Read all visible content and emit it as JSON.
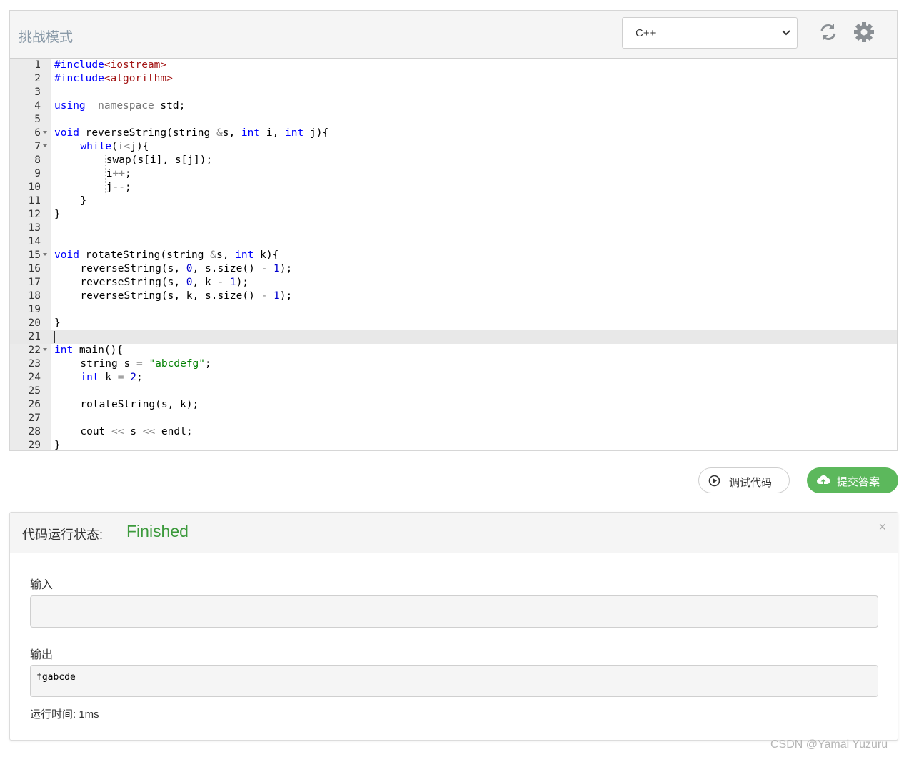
{
  "header": {
    "title": "挑战模式",
    "language_value": "C++",
    "refresh_icon": "refresh-icon",
    "settings_icon": "gear-icon"
  },
  "editor": {
    "lines": [
      {
        "n": "1",
        "fold": false,
        "indent": 0,
        "tokens": [
          [
            "inc",
            "#include"
          ],
          [
            "incf",
            "<iostream>"
          ]
        ]
      },
      {
        "n": "2",
        "fold": false,
        "indent": 0,
        "tokens": [
          [
            "inc",
            "#include"
          ],
          [
            "incf",
            "<algorithm>"
          ]
        ]
      },
      {
        "n": "3",
        "fold": false,
        "indent": 0,
        "tokens": []
      },
      {
        "n": "4",
        "fold": false,
        "indent": 0,
        "tokens": [
          [
            "kw",
            "using"
          ],
          [
            "",
            "  "
          ],
          [
            "gray",
            "namespace"
          ],
          [
            "",
            " std;"
          ]
        ]
      },
      {
        "n": "5",
        "fold": false,
        "indent": 0,
        "tokens": []
      },
      {
        "n": "6",
        "fold": true,
        "indent": 0,
        "tokens": [
          [
            "kw",
            "void"
          ],
          [
            "",
            " reverseString(string "
          ],
          [
            "op",
            "&"
          ],
          [
            "",
            "s, "
          ],
          [
            "kw",
            "int"
          ],
          [
            "",
            " i, "
          ],
          [
            "kw",
            "int"
          ],
          [
            "",
            " j){"
          ]
        ]
      },
      {
        "n": "7",
        "fold": true,
        "indent": 1,
        "tokens": [
          [
            "kw",
            "while"
          ],
          [
            "",
            "(i"
          ],
          [
            "op",
            "<"
          ],
          [
            "",
            "j){"
          ]
        ]
      },
      {
        "n": "8",
        "fold": false,
        "indent": 2,
        "tokens": [
          [
            "",
            "swap(s[i], s[j]);"
          ]
        ]
      },
      {
        "n": "9",
        "fold": false,
        "indent": 2,
        "tokens": [
          [
            "",
            "i"
          ],
          [
            "op",
            "++"
          ],
          [
            "",
            ";"
          ]
        ]
      },
      {
        "n": "10",
        "fold": false,
        "indent": 2,
        "tokens": [
          [
            "",
            "j"
          ],
          [
            "op",
            "--"
          ],
          [
            "",
            ";"
          ]
        ]
      },
      {
        "n": "11",
        "fold": false,
        "indent": 1,
        "tokens": [
          [
            "",
            "}"
          ]
        ]
      },
      {
        "n": "12",
        "fold": false,
        "indent": 0,
        "tokens": [
          [
            "",
            "}"
          ]
        ]
      },
      {
        "n": "13",
        "fold": false,
        "indent": 0,
        "tokens": []
      },
      {
        "n": "14",
        "fold": false,
        "indent": 0,
        "tokens": []
      },
      {
        "n": "15",
        "fold": true,
        "indent": 0,
        "tokens": [
          [
            "kw",
            "void"
          ],
          [
            "",
            " rotateString(string "
          ],
          [
            "op",
            "&"
          ],
          [
            "",
            "s, "
          ],
          [
            "kw",
            "int"
          ],
          [
            "",
            " k){"
          ]
        ]
      },
      {
        "n": "16",
        "fold": false,
        "indent": 1,
        "tokens": [
          [
            "",
            "reverseString(s, "
          ],
          [
            "num",
            "0"
          ],
          [
            "",
            ", s.size() "
          ],
          [
            "op",
            "-"
          ],
          [
            "",
            " "
          ],
          [
            "num",
            "1"
          ],
          [
            "",
            ");"
          ]
        ]
      },
      {
        "n": "17",
        "fold": false,
        "indent": 1,
        "tokens": [
          [
            "",
            "reverseString(s, "
          ],
          [
            "num",
            "0"
          ],
          [
            "",
            ", k "
          ],
          [
            "op",
            "-"
          ],
          [
            "",
            " "
          ],
          [
            "num",
            "1"
          ],
          [
            "",
            ");"
          ]
        ]
      },
      {
        "n": "18",
        "fold": false,
        "indent": 1,
        "tokens": [
          [
            "",
            "reverseString(s, k, s.size() "
          ],
          [
            "op",
            "-"
          ],
          [
            "",
            " "
          ],
          [
            "num",
            "1"
          ],
          [
            "",
            ");"
          ]
        ]
      },
      {
        "n": "19",
        "fold": false,
        "indent": 0,
        "tokens": []
      },
      {
        "n": "20",
        "fold": false,
        "indent": 0,
        "tokens": [
          [
            "",
            "}"
          ]
        ]
      },
      {
        "n": "21",
        "fold": false,
        "indent": 0,
        "tokens": [],
        "active": true
      },
      {
        "n": "22",
        "fold": true,
        "indent": 0,
        "tokens": [
          [
            "kw",
            "int"
          ],
          [
            "",
            " main(){"
          ]
        ]
      },
      {
        "n": "23",
        "fold": false,
        "indent": 1,
        "tokens": [
          [
            "",
            "string s "
          ],
          [
            "op",
            "="
          ],
          [
            "",
            " "
          ],
          [
            "str",
            "\"abcdefg\""
          ],
          [
            "",
            ";"
          ]
        ]
      },
      {
        "n": "24",
        "fold": false,
        "indent": 1,
        "tokens": [
          [
            "kw",
            "int"
          ],
          [
            "",
            " k "
          ],
          [
            "op",
            "="
          ],
          [
            "",
            " "
          ],
          [
            "num",
            "2"
          ],
          [
            "",
            ";"
          ]
        ]
      },
      {
        "n": "25",
        "fold": false,
        "indent": 0,
        "tokens": []
      },
      {
        "n": "26",
        "fold": false,
        "indent": 1,
        "tokens": [
          [
            "",
            "rotateString(s, k);"
          ]
        ]
      },
      {
        "n": "27",
        "fold": false,
        "indent": 0,
        "tokens": []
      },
      {
        "n": "28",
        "fold": false,
        "indent": 1,
        "tokens": [
          [
            "",
            "cout "
          ],
          [
            "op",
            "<<"
          ],
          [
            "",
            " s "
          ],
          [
            "op",
            "<<"
          ],
          [
            "",
            " endl;"
          ]
        ]
      },
      {
        "n": "29",
        "fold": false,
        "indent": 0,
        "tokens": [
          [
            "",
            "}"
          ]
        ]
      }
    ]
  },
  "actions": {
    "debug_label": "调试代码",
    "submit_label": "提交答案",
    "debug_icon": "play-circle-icon",
    "submit_icon": "cloud-upload-icon"
  },
  "result": {
    "status_label": "代码运行状态:",
    "status_value": "Finished",
    "close_label": "×",
    "input_label": "输入",
    "input_value": "",
    "output_label": "输出",
    "output_value": "fgabcde",
    "runtime": "运行时间: 1ms"
  },
  "watermark": "CSDN @Yamai Yuzuru",
  "colors": {
    "success": "#5cb85c",
    "status_text": "#3c9a3c",
    "keyword": "#0000ff",
    "include_file": "#a31515",
    "string": "#008000"
  }
}
